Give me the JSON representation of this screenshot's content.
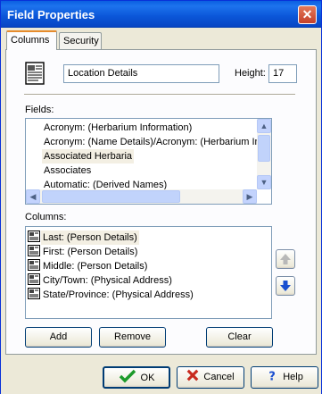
{
  "window": {
    "title": "Field Properties",
    "close_glyph": "✕"
  },
  "tabs": [
    {
      "label": "Columns",
      "active": true
    },
    {
      "label": "Security",
      "active": false
    }
  ],
  "name_field": {
    "value": "Location Details"
  },
  "height": {
    "label": "Height:",
    "value": "17"
  },
  "fields": {
    "label": "Fields:",
    "items": [
      "Acronym: (Herbarium Information)",
      "Acronym: (Name Details)/Acronym: (Herbarium Info",
      "Associated Herbaria",
      "Associates",
      "Automatic: (Derived Names)"
    ],
    "selected_index": 2
  },
  "columns": {
    "label": "Columns:",
    "items": [
      "Last: (Person Details)",
      "First: (Person Details)",
      "Middle: (Person Details)",
      "City/Town: (Physical Address)",
      "State/Province: (Physical Address)"
    ],
    "selected_index": 0
  },
  "buttons": {
    "add": "Add",
    "remove": "Remove",
    "clear": "Clear",
    "ok": "OK",
    "cancel": "Cancel",
    "help": "Help"
  },
  "icons": {
    "document": "document-icon",
    "up_arrow": "up-arrow-icon",
    "down_arrow": "down-arrow-icon",
    "ok": "checkmark-icon",
    "cancel": "x-icon",
    "help": "question-icon"
  },
  "colors": {
    "title_bar": "#0a5fe0",
    "accent_tab": "#e68b2c",
    "selection": "#f3efe3",
    "ok_green": "#1c9a2a",
    "cancel_red": "#c82a1e",
    "arrow_blue": "#1a4fd0"
  }
}
